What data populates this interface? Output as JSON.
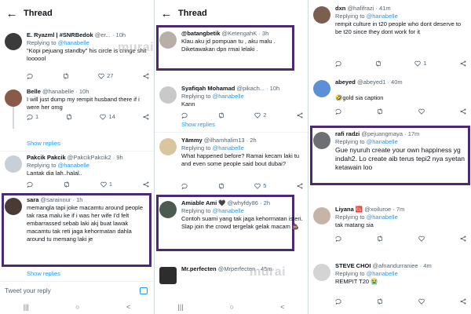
{
  "panel1": {
    "title": "Thread",
    "tweets": [
      {
        "name": "E. Ryazml | #SNRBedok",
        "handle": "@er...",
        "time": "· 10h",
        "reply_to": "@hanabelle",
        "text": "\"Kopi pejuang standby\" his circle is cringe shit loooool",
        "counts": [
          "",
          "",
          "27",
          ""
        ]
      },
      {
        "name": "Belle",
        "handle": "@hanabelle",
        "time": "· 10h",
        "reply_to": "",
        "text": "I will just dump my rempit husband there if i were her omg",
        "counts": [
          "1",
          "",
          "14",
          ""
        ]
      },
      {
        "name": "Pakcik Pakcik",
        "handle": "@PakcikPakcik2",
        "time": "· 9h",
        "reply_to": "@hanabelle",
        "text": "Lantak dia lah..halal..",
        "counts": [
          "",
          "",
          "1",
          ""
        ]
      },
      {
        "name": "sara",
        "handle": "@sarainnur",
        "time": "· 1h",
        "reply_to": "",
        "text": "memangla tapi joke macamtu around people tak rasa malu ke if i was her wife I'd felt embarrassed sebab laki akj buat lawak macamtu tak reti jaga kehormatan dahla around tu memang laki je",
        "counts": [
          "",
          "",
          "",
          ""
        ]
      }
    ],
    "show_replies": "Show replies",
    "reply_placeholder": "Tweet your reply"
  },
  "panel2": {
    "title": "Thread",
    "tweets": [
      {
        "name": "@batangbetik",
        "handle": "@KetengahK",
        "time": "· 3h",
        "reply_to": "",
        "text": "Klau aku jd pompuan tu , aku malu . Diketawakan dpn rmai lelaki .",
        "counts": [
          "",
          "",
          "",
          ""
        ]
      },
      {
        "name": "Syafiqah Mohamad",
        "handle": "@pikach...",
        "time": "· 10h",
        "reply_to": "@hanabelle",
        "text": "Kann",
        "counts": [
          "",
          "",
          "2",
          ""
        ]
      },
      {
        "name": "Yāmmy",
        "handle": "@ilhamhalim13",
        "time": "· 2h",
        "reply_to": "@hanabelle",
        "text": "What happened before? Ramai kecam laki tu and even some people said bout dubai?",
        "counts": [
          "",
          "",
          "5",
          ""
        ]
      },
      {
        "name": "Amiable Ami 🖤",
        "handle": "@whyfdy86",
        "time": "· 2h",
        "reply_to": "@hanabelle",
        "text": "Contoh suami yang tak jaga kehormatan isteri. Slap join the crowd tergelak gelak macam 💩",
        "counts": [
          "",
          "",
          "",
          ""
        ]
      },
      {
        "name": "Mr.perfecten",
        "handle": "@Mrperfecten",
        "time": "· 45m",
        "reply_to": "",
        "text": "",
        "counts": [
          "",
          "",
          "",
          ""
        ]
      }
    ],
    "show_replies": "Show replies"
  },
  "panel3": {
    "tweets": [
      {
        "name": "dxn",
        "handle": "@hafifrazi",
        "time": "· 41m",
        "reply_to": "@hanabelle",
        "text": "rempit culture in t20 people who dont deserve to be t20 since they dont work for it",
        "counts": [
          "",
          "",
          "1",
          ""
        ]
      },
      {
        "name": "abeyed",
        "handle": "@abeyed1",
        "time": "· 40m",
        "reply_to": "",
        "text": "🤣gold sia caption",
        "counts": [
          "",
          "",
          "",
          ""
        ]
      },
      {
        "name": "rafi radzi",
        "handle": "@pejuangmaya",
        "time": "· 17m",
        "reply_to": "@hanabelle",
        "text": "Gue nyuruh create your own happiness yg indah2. Lo create aib terus tepi2 nya syetan ketawain loo",
        "counts": [
          "",
          "",
          "",
          ""
        ]
      },
      {
        "name": "Liyana 🆑",
        "handle": "@xoiluroe",
        "time": "· 7m",
        "reply_to": "@hanabelle",
        "text": "tak matang sia",
        "counts": [
          "",
          "",
          "",
          ""
        ]
      },
      {
        "name": "STEVE CHOI",
        "handle": "@afnandurraniee",
        "time": "· 4m",
        "reply_to": "@hanabelle",
        "text": "REMPIT T20 😭",
        "counts": [
          "",
          "",
          "",
          ""
        ]
      }
    ]
  },
  "common": {
    "replying_prefix": "Replying to "
  },
  "watermark": "murai",
  "colors": {
    "accent": "#1d9bf0",
    "highlight": "#4b2a73",
    "muted": "#536471"
  }
}
